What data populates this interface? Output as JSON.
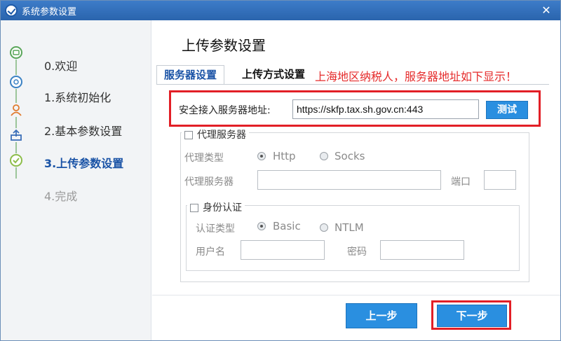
{
  "window": {
    "title": "系统参数设置",
    "close_glyph": "✕",
    "app_icon": "check-circle-icon"
  },
  "steps": [
    {
      "label": "0.欢迎",
      "icon": "welcome-icon",
      "state": "done"
    },
    {
      "label": "1.系统初始化",
      "icon": "settings-icon",
      "state": "done"
    },
    {
      "label": "2.基本参数设置",
      "icon": "user-icon",
      "state": "done"
    },
    {
      "label": "3.上传参数设置",
      "icon": "upload-icon",
      "state": "active"
    },
    {
      "label": "4.完成",
      "icon": "check-icon",
      "state": "pending"
    }
  ],
  "heading": "上传参数设置",
  "tabs": {
    "server": "服务器设置",
    "upload_mode": "上传方式设置",
    "notice": "上海地区纳税人，服务器地址如下显示！"
  },
  "server": {
    "label": "安全接入服务器地址:",
    "value": "https://skfp.tax.sh.gov.cn:443",
    "test_button": "测试"
  },
  "proxy": {
    "checkbox_label": "代理服务器",
    "type_label": "代理类型",
    "type_options": [
      "Http",
      "Socks"
    ],
    "type_selected": "Http",
    "server_label": "代理服务器",
    "port_label": "端口",
    "server_value": "",
    "port_value": ""
  },
  "auth": {
    "checkbox_label": "身份认证",
    "type_label": "认证类型",
    "type_options": [
      "Basic",
      "NTLM"
    ],
    "type_selected": "Basic",
    "username_label": "用户名",
    "password_label": "密码",
    "username_value": "",
    "password_value": ""
  },
  "footer": {
    "prev_button": "上一步",
    "next_button": "下一步"
  },
  "colors": {
    "accent": "#2a8fe0",
    "active_step": "#1a53a6",
    "notice_red": "#e52b2b",
    "highlight_red": "#e21f26",
    "titlebar": "#2a64ad"
  }
}
